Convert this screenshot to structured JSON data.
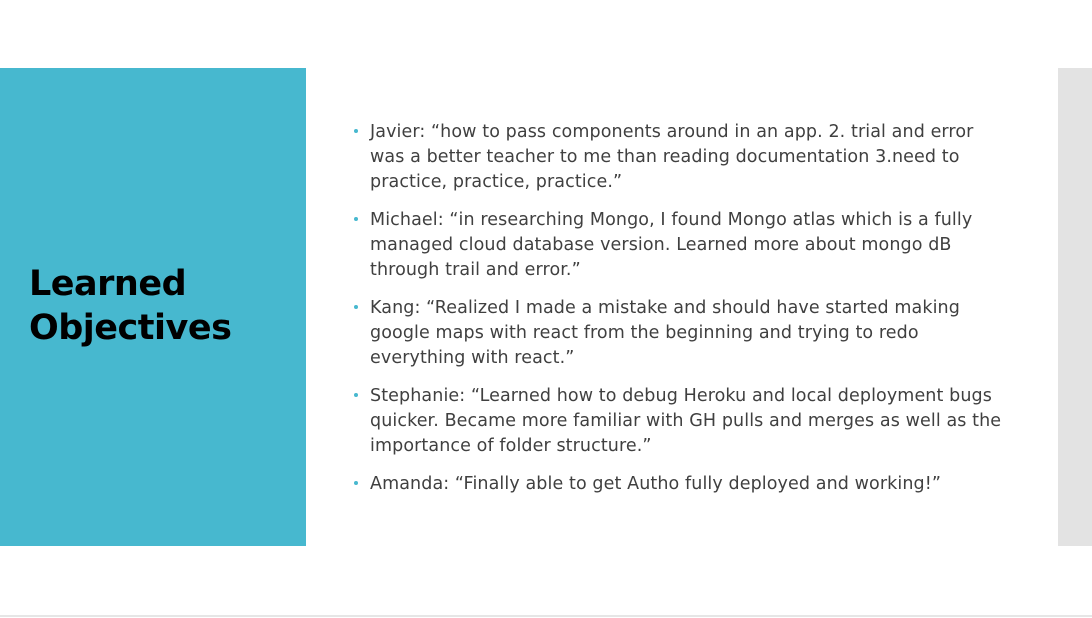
{
  "slide": {
    "title_line1": "Learned",
    "title_line2": "Objectives",
    "bullets": [
      "Javier: “how to pass components around in an app. 2. trial and error was a better teacher to me than reading documentation 3.need to practice, practice, practice.”",
      "Michael: “in researching Mongo, I found Mongo atlas which is a fully managed cloud database version. Learned more about mongo dB through trail and error.”",
      "Kang: “Realized I made a mistake and should have started making google maps with react from the beginning and trying to redo everything with react.”",
      "Stephanie: “Learned how to debug Heroku and local deployment bugs quicker. Became more familiar with GH pulls and merges as well as the importance of folder structure.”",
      "Amanda: “Finally able to get Autho fully deployed and working!”"
    ]
  },
  "colors": {
    "accent": "#47b8cf",
    "title_text": "#000000",
    "body_text": "#404040",
    "side_bar": "#e3e3e3"
  }
}
